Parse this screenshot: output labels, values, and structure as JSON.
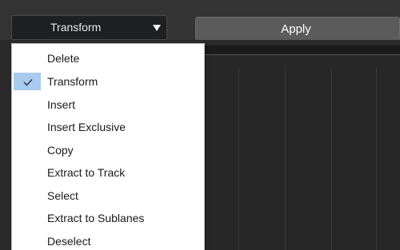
{
  "toolbar": {
    "dropdown_value": "Transform",
    "apply_label": "Apply"
  },
  "menu": {
    "items": [
      {
        "label": "Delete",
        "selected": false
      },
      {
        "label": "Transform",
        "selected": true
      },
      {
        "label": "Insert",
        "selected": false
      },
      {
        "label": "Insert Exclusive",
        "selected": false
      },
      {
        "label": "Copy",
        "selected": false
      },
      {
        "label": "Extract to Track",
        "selected": false
      },
      {
        "label": "Select",
        "selected": false
      },
      {
        "label": "Extract to Sublanes",
        "selected": false
      },
      {
        "label": "Deselect",
        "selected": false
      }
    ]
  },
  "icons": {
    "dropdown_arrow": "triangle-down-icon",
    "selected_check": "check-icon"
  },
  "colors": {
    "selected_highlight": "#a9cbee",
    "toolbar_bg": "#333333",
    "menu_bg": "#ffffff",
    "apply_bg": "#5b5b5b"
  }
}
